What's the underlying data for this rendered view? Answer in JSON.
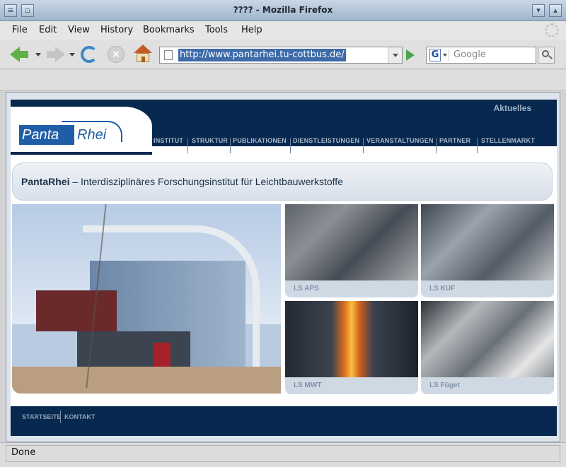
{
  "window": {
    "title": "???? - Mozilla Firefox"
  },
  "menubar": {
    "items": [
      {
        "label": "File"
      },
      {
        "label": "Edit"
      },
      {
        "label": "View"
      },
      {
        "label": "History"
      },
      {
        "label": "Bookmarks"
      },
      {
        "label": "Tools"
      },
      {
        "label": "Help"
      }
    ]
  },
  "navbar": {
    "url": "http://www.pantarhei.tu-cottbus.de/",
    "search_placeholder": "Google",
    "search_engine_icon": "G"
  },
  "site": {
    "aktuelles": "Aktuelles",
    "logo": {
      "panta": "Panta",
      "rhei": "Rhei"
    },
    "nav": [
      {
        "label": "INSTITUT"
      },
      {
        "label": "STRUKTUR"
      },
      {
        "label": "PUBLIKATIONEN"
      },
      {
        "label": "DIENSTLEISTUNGEN"
      },
      {
        "label": "VERANSTALTUNGEN"
      },
      {
        "label": "PARTNER"
      },
      {
        "label": "STELLENMARKT"
      }
    ],
    "tagline": {
      "brand": "PantaRhei",
      "rest": " – Interdisziplinäres Forschungsinstitut für Leichtbauwerkstoffe"
    },
    "tiles": [
      {
        "caption": "LS APS"
      },
      {
        "caption": "LS KUF"
      },
      {
        "caption": "LS MWT"
      },
      {
        "caption": "LS Füget"
      }
    ],
    "footer": [
      {
        "label": "STARTSEITE"
      },
      {
        "label": "KONTAKT"
      }
    ]
  },
  "status": {
    "text": "Done"
  },
  "colors": {
    "site_navy": "#07284f",
    "logo_blue": "#1f5ea6",
    "url_selection": "#3d6aa8"
  }
}
